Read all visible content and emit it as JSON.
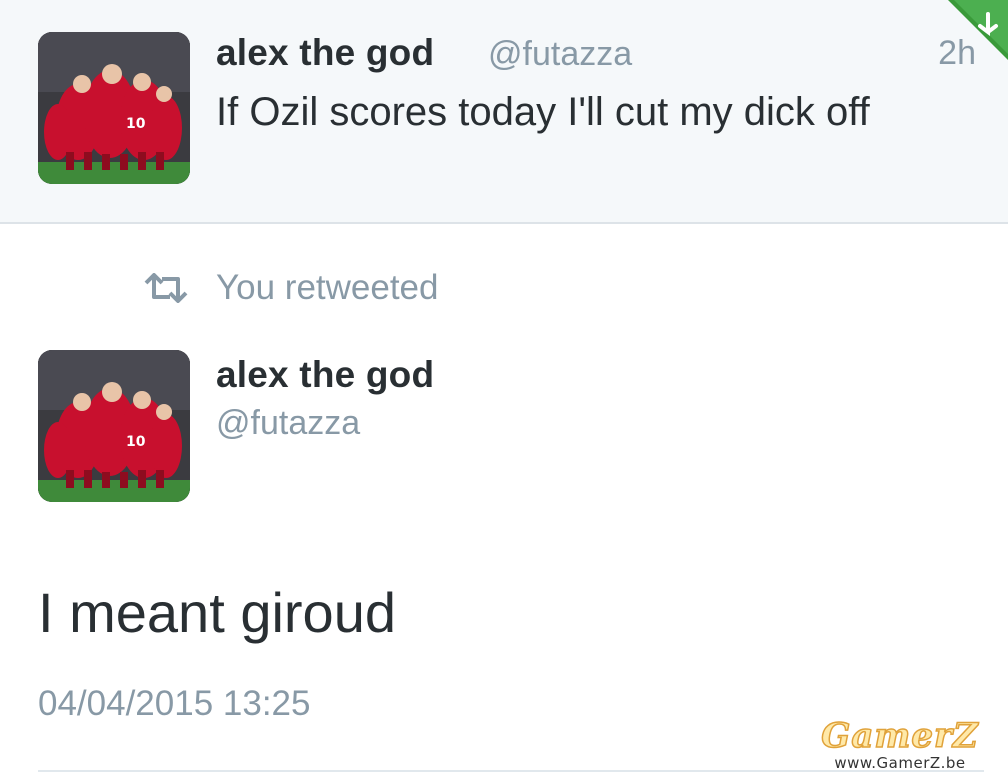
{
  "quoted_tweet": {
    "display_name": "alex the god",
    "handle": "@futazza",
    "time_ago": "2h",
    "text": "If Ozil scores today I'll cut my dick off",
    "avatar_icon": "team-huddle-avatar"
  },
  "retweet_context": {
    "label": "You retweeted",
    "icon": "retweet-icon"
  },
  "detail_tweet": {
    "display_name": "alex the god",
    "handle": "@futazza",
    "text": "I meant giroud",
    "timestamp": "04/04/2015 13:25",
    "avatar_icon": "team-huddle-avatar"
  },
  "watermark": {
    "logo": "GamerZ",
    "url": "www.GamerZ.be"
  },
  "colors": {
    "name": "#292f33",
    "meta_gray": "#8899a6",
    "top_background": "#f5f8fa",
    "kit_red": "#c8102e",
    "flag_green": "#3a9a3a"
  }
}
